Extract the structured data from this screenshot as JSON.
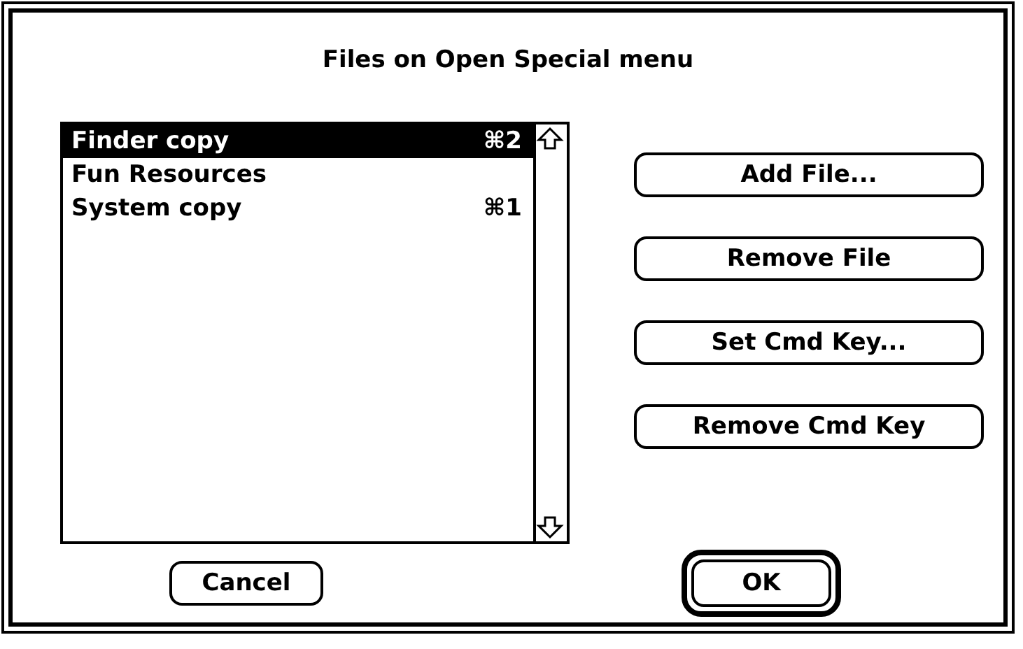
{
  "dialog": {
    "title": "Files on Open Special menu"
  },
  "files": [
    {
      "name": "Finder copy",
      "shortcut": "⌘2",
      "selected": true
    },
    {
      "name": "Fun Resources",
      "selected": false
    },
    {
      "name": "System copy",
      "shortcut": "⌘1",
      "selected": false
    }
  ],
  "side_buttons": [
    "Add File...",
    "Remove File",
    "Set Cmd Key...",
    "Remove Cmd Key"
  ],
  "cancel_button": "Cancel",
  "ok_button": {
    "label": "OK",
    "default": true
  }
}
